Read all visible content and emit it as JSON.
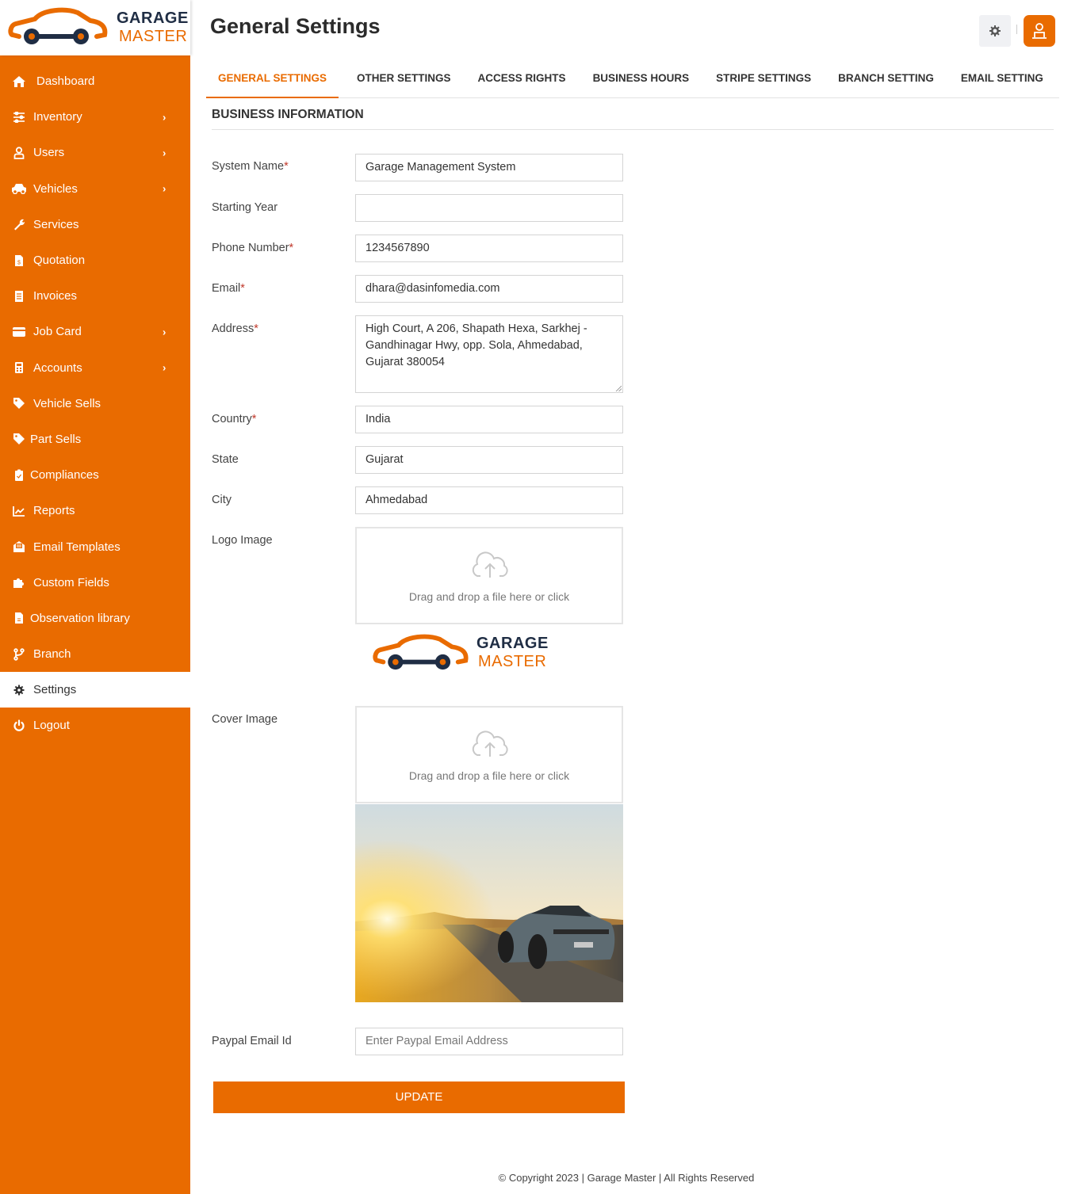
{
  "brand": {
    "line1": "GARAGE",
    "line2": "MASTER"
  },
  "sidebar": {
    "items": [
      {
        "label": "Dashboard",
        "icon": "home-icon",
        "has_submenu": false
      },
      {
        "label": "Inventory",
        "icon": "sliders-icon",
        "has_submenu": true
      },
      {
        "label": "Users",
        "icon": "user-icon",
        "has_submenu": true
      },
      {
        "label": "Vehicles",
        "icon": "car-icon",
        "has_submenu": true
      },
      {
        "label": "Services",
        "icon": "wrench-icon",
        "has_submenu": false
      },
      {
        "label": "Quotation",
        "icon": "invoice-dollar-icon",
        "has_submenu": false
      },
      {
        "label": "Invoices",
        "icon": "receipt-icon",
        "has_submenu": false
      },
      {
        "label": "Job Card",
        "icon": "credit-card-icon",
        "has_submenu": true
      },
      {
        "label": "Accounts",
        "icon": "calculator-icon",
        "has_submenu": true
      },
      {
        "label": "Vehicle Sells",
        "icon": "tag-icon",
        "has_submenu": false
      },
      {
        "label": "Part Sells",
        "icon": "tag-icon",
        "has_submenu": false
      },
      {
        "label": "Compliances",
        "icon": "clipboard-check-icon",
        "has_submenu": false
      },
      {
        "label": "Reports",
        "icon": "line-chart-icon",
        "has_submenu": false
      },
      {
        "label": "Email Templates",
        "icon": "envelope-open-icon",
        "has_submenu": false
      },
      {
        "label": "Custom Fields",
        "icon": "puzzle-icon",
        "has_submenu": false
      },
      {
        "label": "Observation library",
        "icon": "file-icon",
        "has_submenu": false
      },
      {
        "label": "Branch",
        "icon": "code-branch-icon",
        "has_submenu": false
      },
      {
        "label": "Settings",
        "icon": "gear-icon",
        "has_submenu": false,
        "active": true
      },
      {
        "label": "Logout",
        "icon": "power-icon",
        "has_submenu": false
      }
    ],
    "chevron": "›"
  },
  "header": {
    "title": "General Settings"
  },
  "tabs": [
    {
      "label": "GENERAL SETTINGS",
      "active": true
    },
    {
      "label": "OTHER SETTINGS"
    },
    {
      "label": "ACCESS RIGHTS"
    },
    {
      "label": "BUSINESS HOURS"
    },
    {
      "label": "STRIPE SETTINGS"
    },
    {
      "label": "BRANCH SETTING"
    },
    {
      "label": "EMAIL SETTING"
    }
  ],
  "form": {
    "section_title": "BUSINESS INFORMATION",
    "required_mark": "*",
    "system_name": {
      "label": "System Name",
      "value": "Garage Management System"
    },
    "starting_year": {
      "label": "Starting Year",
      "value": ""
    },
    "phone": {
      "label": "Phone Number",
      "value": "1234567890"
    },
    "email": {
      "label": "Email",
      "value": "dhara@dasinfomedia.com"
    },
    "address": {
      "label": "Address",
      "value": "High Court, A 206, Shapath Hexa, Sarkhej - Gandhinagar Hwy, opp. Sola, Ahmedabad, Gujarat 380054"
    },
    "country": {
      "label": "Country",
      "value": "India"
    },
    "state": {
      "label": "State",
      "value": "Gujarat"
    },
    "city": {
      "label": "City",
      "value": "Ahmedabad"
    },
    "logo_image": {
      "label": "Logo Image",
      "dropzone_text": "Drag and drop a file here or click"
    },
    "cover_image": {
      "label": "Cover Image",
      "dropzone_text": "Drag and drop a file here or click"
    },
    "paypal": {
      "label": "Paypal Email Id",
      "value": "",
      "placeholder": "Enter Paypal Email Address"
    },
    "update_label": "UPDATE"
  },
  "footer": {
    "text": "© Copyright 2023 | Garage Master | All Rights Reserved"
  },
  "colors": {
    "accent": "#e96b00",
    "navy": "#1f2d44"
  }
}
